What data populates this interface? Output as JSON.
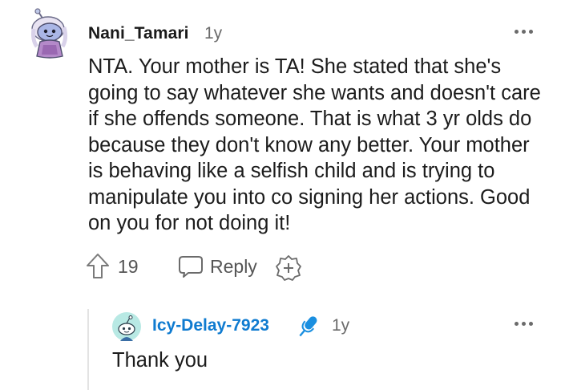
{
  "comment": {
    "username": "Nani_Tamari",
    "age": "1y",
    "body": "NTA. Your mother is TA! She stated that she's going to say whatever she wants and doesn't care if she offends someone. That is what 3 yr olds do because they don't know any better. Your mother is behaving like a selfish child and is trying to manipulate you into co signing her actions. Good on you for not doing it!",
    "votes": "19",
    "reply_label": "Reply",
    "avatar_icon": "snoo-avatar-icon",
    "more_icon": "more-options-icon"
  },
  "reply": {
    "username": "Icy-Delay-7923",
    "age": "1y",
    "body": "Thank you",
    "badge_icon": "microphone-icon",
    "avatar_icon": "snoo-default-avatar-icon"
  },
  "colors": {
    "reply_username": "#0f7bd0",
    "muted_text": "#6b6b6b",
    "thread_line": "#e3e3e3",
    "microphone": "#1a8fe0"
  }
}
